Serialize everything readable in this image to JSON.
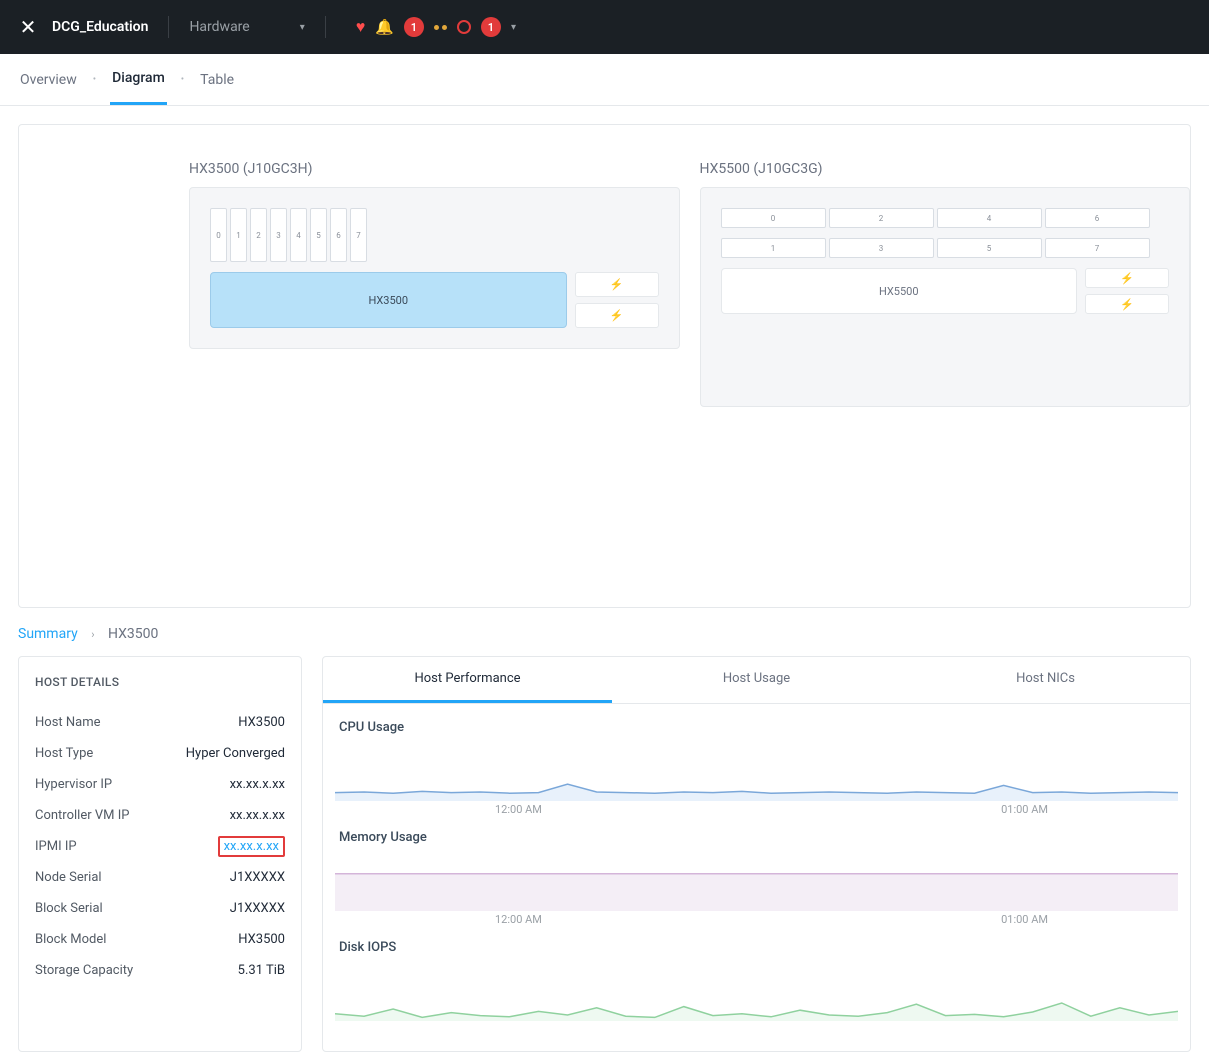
{
  "topbar": {
    "cluster_name": "DCG_Education",
    "menu_label": "Hardware",
    "badge1": "1",
    "badge2": "1"
  },
  "subnav": {
    "overview": "Overview",
    "diagram": "Diagram",
    "table": "Table"
  },
  "blocks": [
    {
      "title": "HX3500 (J10GC3H)",
      "drive_layout": "vertical",
      "drives": [
        "0",
        "1",
        "2",
        "3",
        "4",
        "5",
        "6",
        "7"
      ],
      "node_label": "HX3500",
      "selected": true,
      "psu_slots": 2
    },
    {
      "title": "HX5500 (J10GC3G)",
      "drive_layout": "wide",
      "drives_row1": [
        "0",
        "2",
        "4",
        "6"
      ],
      "drives_row2": [
        "1",
        "3",
        "5",
        "7"
      ],
      "node_label": "HX5500",
      "selected": false,
      "psu_slots": 2
    }
  ],
  "breadcrumb": {
    "root": "Summary",
    "current": "HX3500"
  },
  "host_details": {
    "heading": "HOST DETAILS",
    "rows": [
      {
        "label": "Host Name",
        "value": "HX3500"
      },
      {
        "label": "Host Type",
        "value": "Hyper Converged"
      },
      {
        "label": "Hypervisor IP",
        "value": "xx.xx.x.xx"
      },
      {
        "label": "Controller VM IP",
        "value": "xx.xx.x.xx"
      },
      {
        "label": "IPMI IP",
        "value": "xx.xx.x.xx",
        "highlight": true,
        "link": true
      },
      {
        "label": "Node Serial",
        "value": "J1XXXXX"
      },
      {
        "label": "Block Serial",
        "value": "J1XXXXX"
      },
      {
        "label": "Block Model",
        "value": "HX3500"
      },
      {
        "label": "Storage Capacity",
        "value": "5.31 TiB"
      }
    ]
  },
  "perf_tabs": {
    "t1": "Host Performance",
    "t2": "Host Usage",
    "t3": "Host NICs"
  },
  "charts": {
    "cpu": "CPU Usage",
    "mem": "Memory Usage",
    "iops": "Disk IOPS",
    "x0": "12:00 AM",
    "x1": "01:00 AM"
  },
  "chart_data": [
    {
      "type": "area",
      "title": "CPU Usage",
      "xlabel": "",
      "ylabel": "",
      "x_ticks": [
        "12:00 AM",
        "01:00 AM"
      ],
      "series": [
        {
          "name": "cpu",
          "values": [
            14,
            15,
            13,
            16,
            14,
            15,
            13,
            14,
            28,
            15,
            14,
            13,
            15,
            14,
            16,
            13,
            14,
            15,
            14,
            13,
            15,
            14,
            13,
            26,
            14,
            15,
            13,
            14,
            15,
            14
          ]
        }
      ],
      "ylim": [
        0,
        100
      ],
      "color": "#7aa7d9",
      "fill": "#e8f1fb"
    },
    {
      "type": "area",
      "title": "Memory Usage",
      "xlabel": "",
      "ylabel": "",
      "x_ticks": [
        "12:00 AM",
        "01:00 AM"
      ],
      "series": [
        {
          "name": "mem",
          "values": [
            62,
            62,
            62,
            62,
            62,
            62,
            62,
            62,
            62,
            62,
            62,
            62,
            62,
            62,
            62,
            62,
            62,
            62,
            62,
            62,
            62,
            62,
            62,
            62,
            62,
            62,
            62,
            62,
            62,
            62
          ]
        }
      ],
      "ylim": [
        0,
        100
      ],
      "color": "#d4b5d9",
      "fill": "#f4eef6"
    },
    {
      "type": "area",
      "title": "Disk IOPS",
      "xlabel": "",
      "ylabel": "",
      "x_ticks": [
        "12:00 AM",
        "01:00 AM"
      ],
      "series": [
        {
          "name": "iops",
          "values": [
            12,
            8,
            20,
            6,
            14,
            9,
            7,
            16,
            10,
            22,
            8,
            6,
            24,
            9,
            12,
            7,
            18,
            10,
            8,
            14,
            28,
            9,
            11,
            7,
            15,
            30,
            8,
            22,
            10,
            16
          ]
        }
      ],
      "ylim": [
        0,
        100
      ],
      "color": "#8fd19e",
      "fill": "#eef9f1"
    }
  ]
}
